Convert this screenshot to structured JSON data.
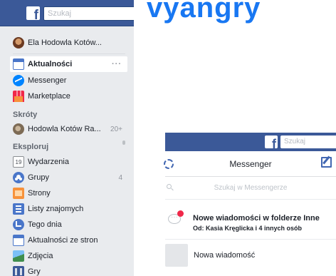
{
  "desktop": {
    "search_placeholder": "Szukaj",
    "logo_letter": "f",
    "sidebar": {
      "profile": "Ela Hodowla Kotów...",
      "news_feed": "Aktualności",
      "news_more": "···",
      "messenger": "Messenger",
      "marketplace": "Marketplace",
      "shortcuts_heading": "Skróty",
      "shortcut_page": "Hodowla Kotów Ra...",
      "shortcut_count": "20+",
      "explore_heading": "Eksploruj",
      "events": "Wydarzenia",
      "events_day": "19",
      "groups": "Grupy",
      "groups_count": "4",
      "pages": "Strony",
      "friend_lists": "Listy znajomych",
      "on_this_day": "Tego dnia",
      "pages_feed": "Aktualności ze stron",
      "photos": "Zdjęcia",
      "games": "Gry"
    }
  },
  "title_fragment": "vyangry",
  "messenger": {
    "logo_letter": "f",
    "search_placeholder": "Szukaj",
    "title": "Messenger",
    "search_messenger_placeholder": "Szukaj w Messengerze",
    "new_messages_title": "Nowe wiadomości w folderze Inne",
    "new_messages_sub": "Od: Kasia Kręglicka i 4 innych osób",
    "new_message": "Nowa wiadomość"
  },
  "colors": {
    "facebook_blue": "#3b5998",
    "sidebar_bg": "#e9ebee",
    "title_blue": "#1877f2",
    "notification_red": "#f02849"
  }
}
